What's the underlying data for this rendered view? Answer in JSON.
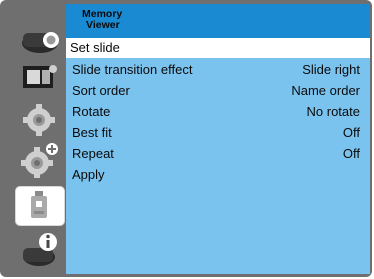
{
  "header": {
    "title_line1": "Memory",
    "title_line2": "Viewer"
  },
  "menu": [
    {
      "label": "Set slide",
      "value": "",
      "selected": true
    },
    {
      "label": "Slide transition effect",
      "value": "Slide right"
    },
    {
      "label": "Sort order",
      "value": "Name order"
    },
    {
      "label": "Rotate",
      "value": "No rotate"
    },
    {
      "label": "Best fit",
      "value": "Off"
    },
    {
      "label": "Repeat",
      "value": "Off"
    },
    {
      "label": "Apply",
      "value": ""
    }
  ],
  "sidebar": {
    "items": [
      {
        "icon": "projector-icon",
        "active": false
      },
      {
        "icon": "image-adjust-icon",
        "active": false
      },
      {
        "icon": "setting-gear-icon",
        "active": false
      },
      {
        "icon": "expanded-setting-icon",
        "active": false
      },
      {
        "icon": "usb-memory-icon",
        "active": true
      },
      {
        "icon": "info-icon",
        "active": false
      }
    ]
  },
  "colors": {
    "panel_bg": "#7bc3ef",
    "header_bg": "#1a8ad2",
    "frame_bg": "#6f6f6f",
    "selected_row_bg": "#ffffff"
  }
}
